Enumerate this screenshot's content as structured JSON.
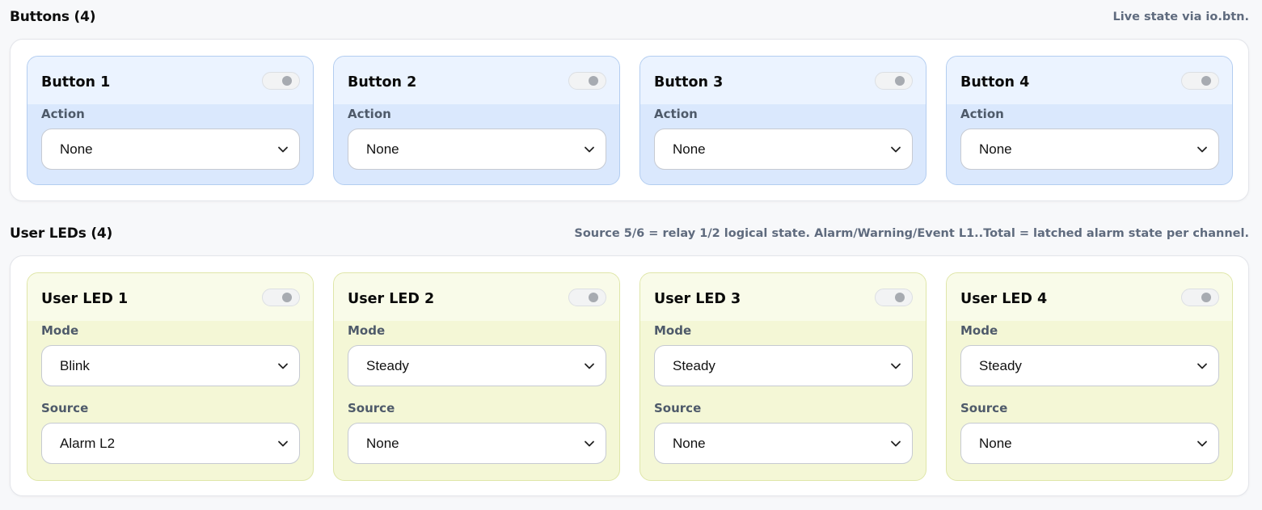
{
  "buttons_section": {
    "title": "Buttons (4)",
    "note": "Live state via io.btn.",
    "items": [
      {
        "name": "Button 1",
        "action_label": "Action",
        "action_value": "None"
      },
      {
        "name": "Button 2",
        "action_label": "Action",
        "action_value": "None"
      },
      {
        "name": "Button 3",
        "action_label": "Action",
        "action_value": "None"
      },
      {
        "name": "Button 4",
        "action_label": "Action",
        "action_value": "None"
      }
    ]
  },
  "leds_section": {
    "title": "User LEDs (4)",
    "note": "Source 5/6 = relay 1/2 logical state. Alarm/Warning/Event L1..Total = latched alarm state per channel.",
    "items": [
      {
        "name": "User LED 1",
        "mode_label": "Mode",
        "mode_value": "Blink",
        "source_label": "Source",
        "source_value": "Alarm L2"
      },
      {
        "name": "User LED 2",
        "mode_label": "Mode",
        "mode_value": "Steady",
        "source_label": "Source",
        "source_value": "None"
      },
      {
        "name": "User LED 3",
        "mode_label": "Mode",
        "mode_value": "Steady",
        "source_label": "Source",
        "source_value": "None"
      },
      {
        "name": "User LED 4",
        "mode_label": "Mode",
        "mode_value": "Steady",
        "source_label": "Source",
        "source_value": "None"
      }
    ]
  },
  "icons": {
    "dropdown": "chevron-down-icon",
    "toggle": "toggle-switch"
  },
  "colors": {
    "button_card_bg": "#dae8fd",
    "led_card_bg": "#f4f7d6",
    "note_text": "#5f6b7e"
  }
}
